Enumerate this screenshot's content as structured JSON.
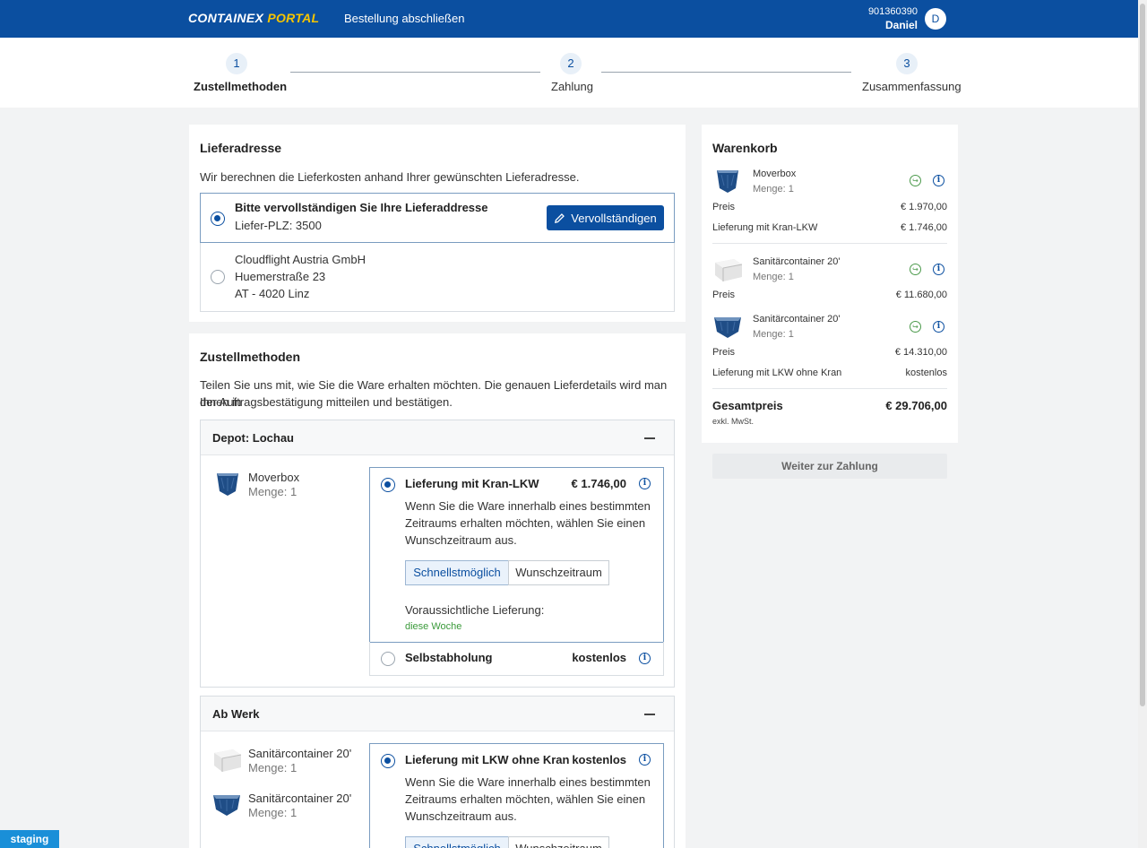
{
  "header": {
    "logo_part1": "CONTAINEX",
    "logo_part2": "PORTAL",
    "title": "Bestellung abschließen",
    "user_number": "901360390",
    "user_name": "Daniel",
    "avatar_initial": "D"
  },
  "stepper": {
    "steps": [
      {
        "num": "1",
        "label": "Zustellmethoden"
      },
      {
        "num": "2",
        "label": "Zahlung"
      },
      {
        "num": "3",
        "label": "Zusammenfassung"
      }
    ]
  },
  "address": {
    "title": "Lieferadresse",
    "description": "Wir berechnen die Lieferkosten anhand Ihrer gewünschten Lieferadresse.",
    "option1_title": "Bitte vervollständigen Sie Ihre Lieferaddresse",
    "option1_sub": "Liefer-PLZ: 3500",
    "complete_button": "Vervollständigen",
    "option2_line1": "Cloudflight Austria GmbH",
    "option2_line2": "Huemerstraße 23",
    "option2_line3": "AT - 4020 Linz"
  },
  "delivery": {
    "title": "Zustellmethoden",
    "description_line1": "Teilen Sie uns mit, wie Sie die Ware erhalten möchten. Die genauen Lieferdetails wird man Ihnen in",
    "description_line2": "der Auftragsbestätigung mitteilen und bestätigen.",
    "depot1": {
      "title": "Depot: Lochau",
      "product_name": "Moverbox",
      "product_qty": "Menge: 1",
      "option1_title": "Lieferung mit Kran-LKW",
      "option1_price": "€ 1.746,00",
      "option_text1": "Wenn Sie die Ware innerhalb eines bestimmten",
      "option_text2": "Zeitraums erhalten möchten, wählen Sie einen",
      "option_text3": "Wunschzeitraum aus.",
      "seg_fast": "Schnellstmöglich",
      "seg_custom": "Wunschzeitraum",
      "expected_label": "Voraussichtliche Lieferung:",
      "expected_value": "diese Woche",
      "option2_title": "Selbstabholung",
      "option2_price": "kostenlos"
    },
    "depot2": {
      "title": "Ab Werk",
      "product1_name": "Sanitärcontainer 20'",
      "product1_qty": "Menge: 1",
      "product2_name": "Sanitärcontainer 20'",
      "product2_qty": "Menge: 1",
      "option1_title": "Lieferung mit LKW ohne Kran",
      "option1_price": "kostenlos",
      "option_text1": "Wenn Sie die Ware innerhalb eines bestimmten",
      "option_text2": "Zeitraums erhalten möchten, wählen Sie einen",
      "option_text3": "Wunschzeitraum aus.",
      "seg_fast": "Schnellstmöglich",
      "seg_custom": "Wunschzeitraum"
    }
  },
  "cart": {
    "title": "Warenkorb",
    "item1_name": "Moverbox",
    "item1_qty": "Menge: 1",
    "item1_price_label": "Preis",
    "item1_price": "€ 1.970,00",
    "item1_delivery_label": "Lieferung mit Kran-LKW",
    "item1_delivery_price": "€ 1.746,00",
    "item2_name": "Sanitärcontainer 20'",
    "item2_qty": "Menge: 1",
    "item2_price_label": "Preis",
    "item2_price": "€ 11.680,00",
    "item3_name": "Sanitärcontainer 20'",
    "item3_qty": "Menge: 1",
    "item3_price_label": "Preis",
    "item3_price": "€ 14.310,00",
    "item3_delivery_label": "Lieferung mit LKW ohne Kran",
    "item3_delivery_price": "kostenlos",
    "total_label": "Gesamtpreis",
    "total_value": "€ 29.706,00",
    "total_note": "exkl. MwSt.",
    "next_button": "Weiter zur Zahlung"
  },
  "env_badge": "staging",
  "colors": {
    "brand_blue": "#0b4fa0",
    "logo_yellow": "#f5c400",
    "success_green": "#3a9a3a",
    "staging_blue": "#1a8fd8"
  },
  "icons": [
    "pencil-icon",
    "info-icon",
    "eco-delivery-icon",
    "minus-icon",
    "container-icon"
  ]
}
